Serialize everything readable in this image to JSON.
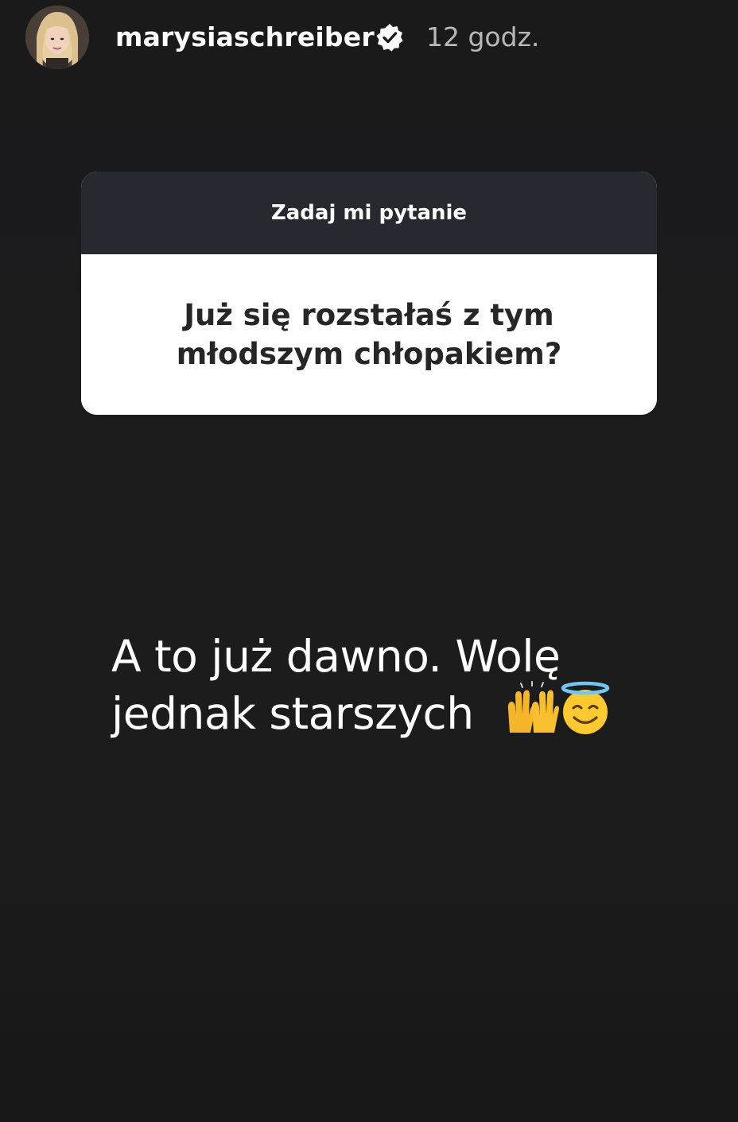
{
  "header": {
    "username": "marysiaschreiber",
    "timestamp": "12 godz.",
    "verified_icon": "verified-badge-icon",
    "avatar": "profile-avatar"
  },
  "question_sticker": {
    "title": "Zadaj mi pytanie",
    "question": "Już się rozstałaś z tym młodszym chłopakiem?",
    "header_color": "#262a30"
  },
  "answer": {
    "text_line1": "A to już dawno. Wolę",
    "text_line2": "jednak starszych",
    "emojis": [
      "raising-hands-emoji",
      "smiling-face-with-halo-emoji"
    ]
  },
  "colors": {
    "background": "#1b1b1c",
    "text": "#ffffff",
    "timestamp": "#b8b8b8"
  }
}
